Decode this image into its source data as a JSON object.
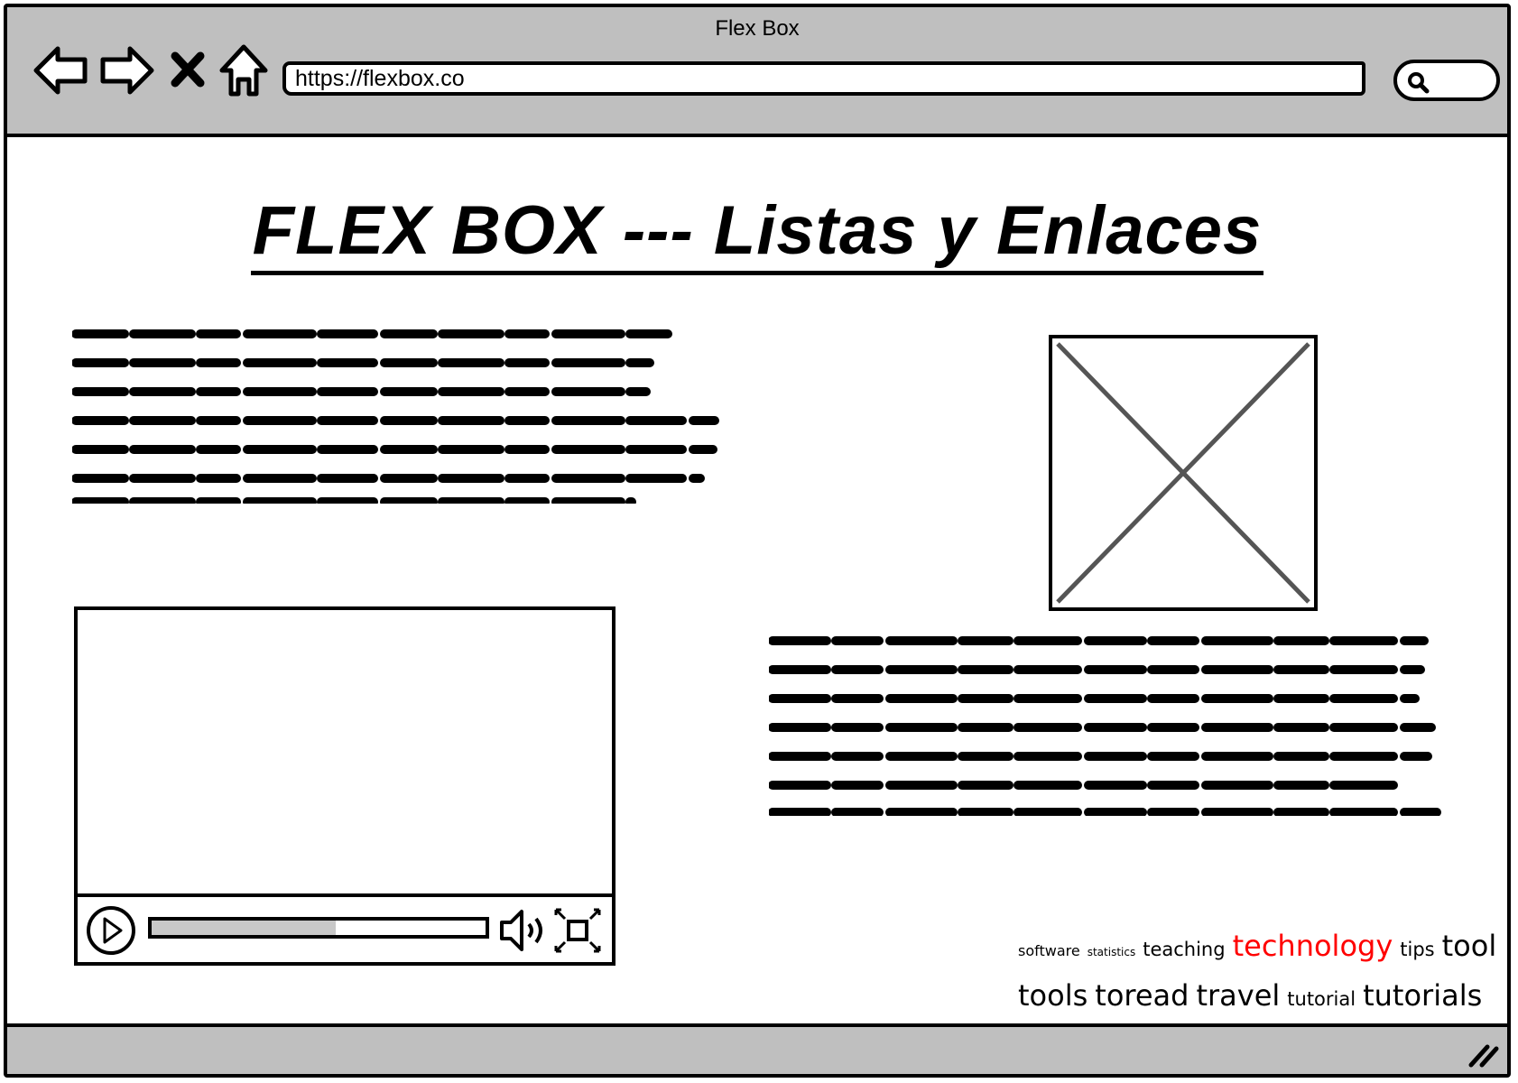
{
  "window": {
    "title": "Flex Box"
  },
  "browser": {
    "url": "https://flexbox.co",
    "buttons": [
      "back",
      "forward",
      "stop",
      "home"
    ]
  },
  "page": {
    "heading": "FLEX BOX --- Listas y Enlaces"
  },
  "video_player": {
    "progress": 0.55
  },
  "tag_cloud": {
    "tags": [
      {
        "label": "software",
        "size": "small"
      },
      {
        "label": "statistics",
        "size": "tiny"
      },
      {
        "label": "teaching",
        "size": "medium-small"
      },
      {
        "label": "technology",
        "size": "large",
        "color": "#ff0000"
      },
      {
        "label": "tips",
        "size": "medium-small"
      },
      {
        "label": "tool",
        "size": "large"
      },
      {
        "label": "tools",
        "size": "large"
      },
      {
        "label": "toread",
        "size": "large"
      },
      {
        "label": "travel",
        "size": "large"
      },
      {
        "label": "tutorial",
        "size": "medium-small"
      },
      {
        "label": "tutorials",
        "size": "large"
      }
    ]
  },
  "colors": {
    "chrome": "#bfbfbf",
    "accent_tag": "#ff0000",
    "placeholder_x": "#555555"
  },
  "icons": [
    "back-arrow-icon",
    "forward-arrow-icon",
    "stop-icon",
    "home-icon",
    "search-icon",
    "play-icon",
    "volume-icon",
    "fullscreen-icon",
    "resize-grip-icon"
  ]
}
